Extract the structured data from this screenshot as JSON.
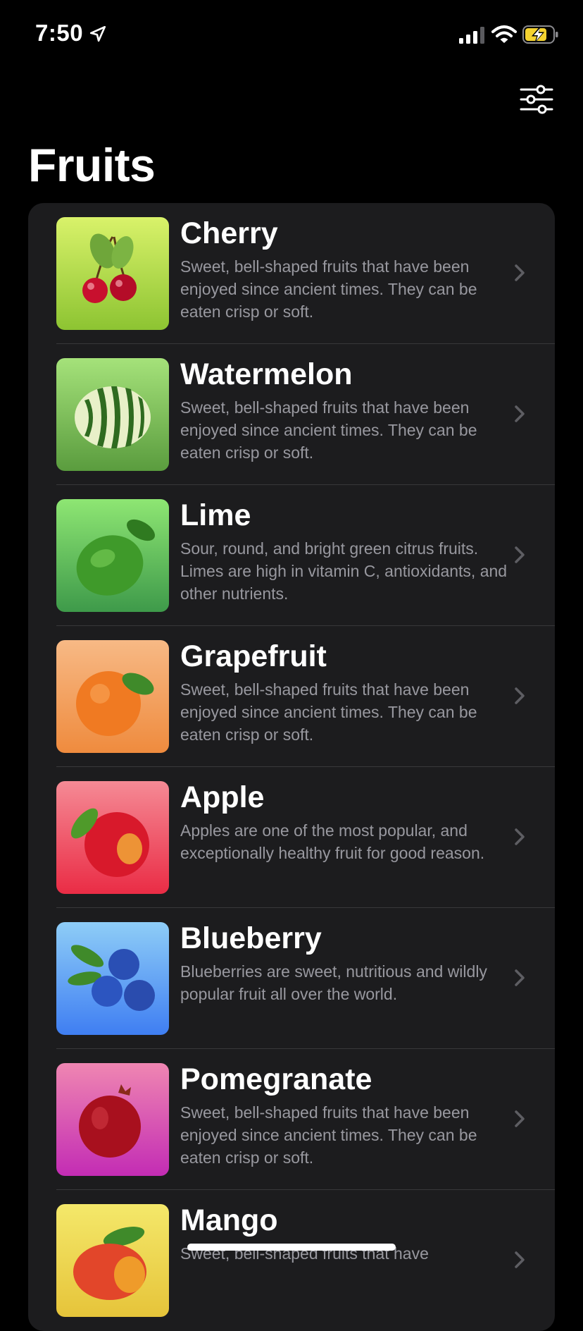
{
  "status_bar": {
    "time": "7:50"
  },
  "header": {
    "title": "Fruits",
    "filter_icon": "sliders-icon"
  },
  "fruits": [
    {
      "name": "Cherry",
      "description": "Sweet, bell-shaped fruits that have been enjoyed since ancient times. They can be eaten crisp or soft.",
      "gradient": [
        "#d9f26a",
        "#8dc432"
      ],
      "icon": "cherry-icon"
    },
    {
      "name": "Watermelon",
      "description": "Sweet, bell-shaped fruits that have been enjoyed since ancient times. They can be eaten crisp or soft.",
      "gradient": [
        "#a5e27a",
        "#5a9c3e"
      ],
      "icon": "watermelon-icon"
    },
    {
      "name": "Lime",
      "description": "Sour, round, and bright green citrus fruits. Limes are high in vitamin C, antioxidants, and other nutrients.",
      "gradient": [
        "#8ee673",
        "#3e9a4a"
      ],
      "icon": "lime-icon"
    },
    {
      "name": "Grapefruit",
      "description": "Sweet, bell-shaped fruits that have been enjoyed since ancient times. They can be eaten crisp or soft.",
      "gradient": [
        "#f7b985",
        "#ef8b3e"
      ],
      "icon": "grapefruit-icon"
    },
    {
      "name": "Apple",
      "description": "Apples are one of the most popular, and exceptionally healthy fruit for good reason.",
      "gradient": [
        "#f58a95",
        "#ea2c45"
      ],
      "icon": "apple-icon"
    },
    {
      "name": "Blueberry",
      "description": "Blueberries are sweet, nutritious and wildly popular fruit all over the world.",
      "gradient": [
        "#8ecdf7",
        "#3f7ef2"
      ],
      "icon": "blueberry-icon"
    },
    {
      "name": "Pomegranate",
      "description": "Sweet, bell-shaped fruits that have been enjoyed since ancient times. They can be eaten crisp or soft.",
      "gradient": [
        "#ef86b2",
        "#c32cb4"
      ],
      "icon": "pomegranate-icon"
    },
    {
      "name": "Mango",
      "description": "Sweet, bell-shaped fruits that have",
      "gradient": [
        "#f4e86a",
        "#e6c43a"
      ],
      "icon": "mango-icon"
    }
  ]
}
